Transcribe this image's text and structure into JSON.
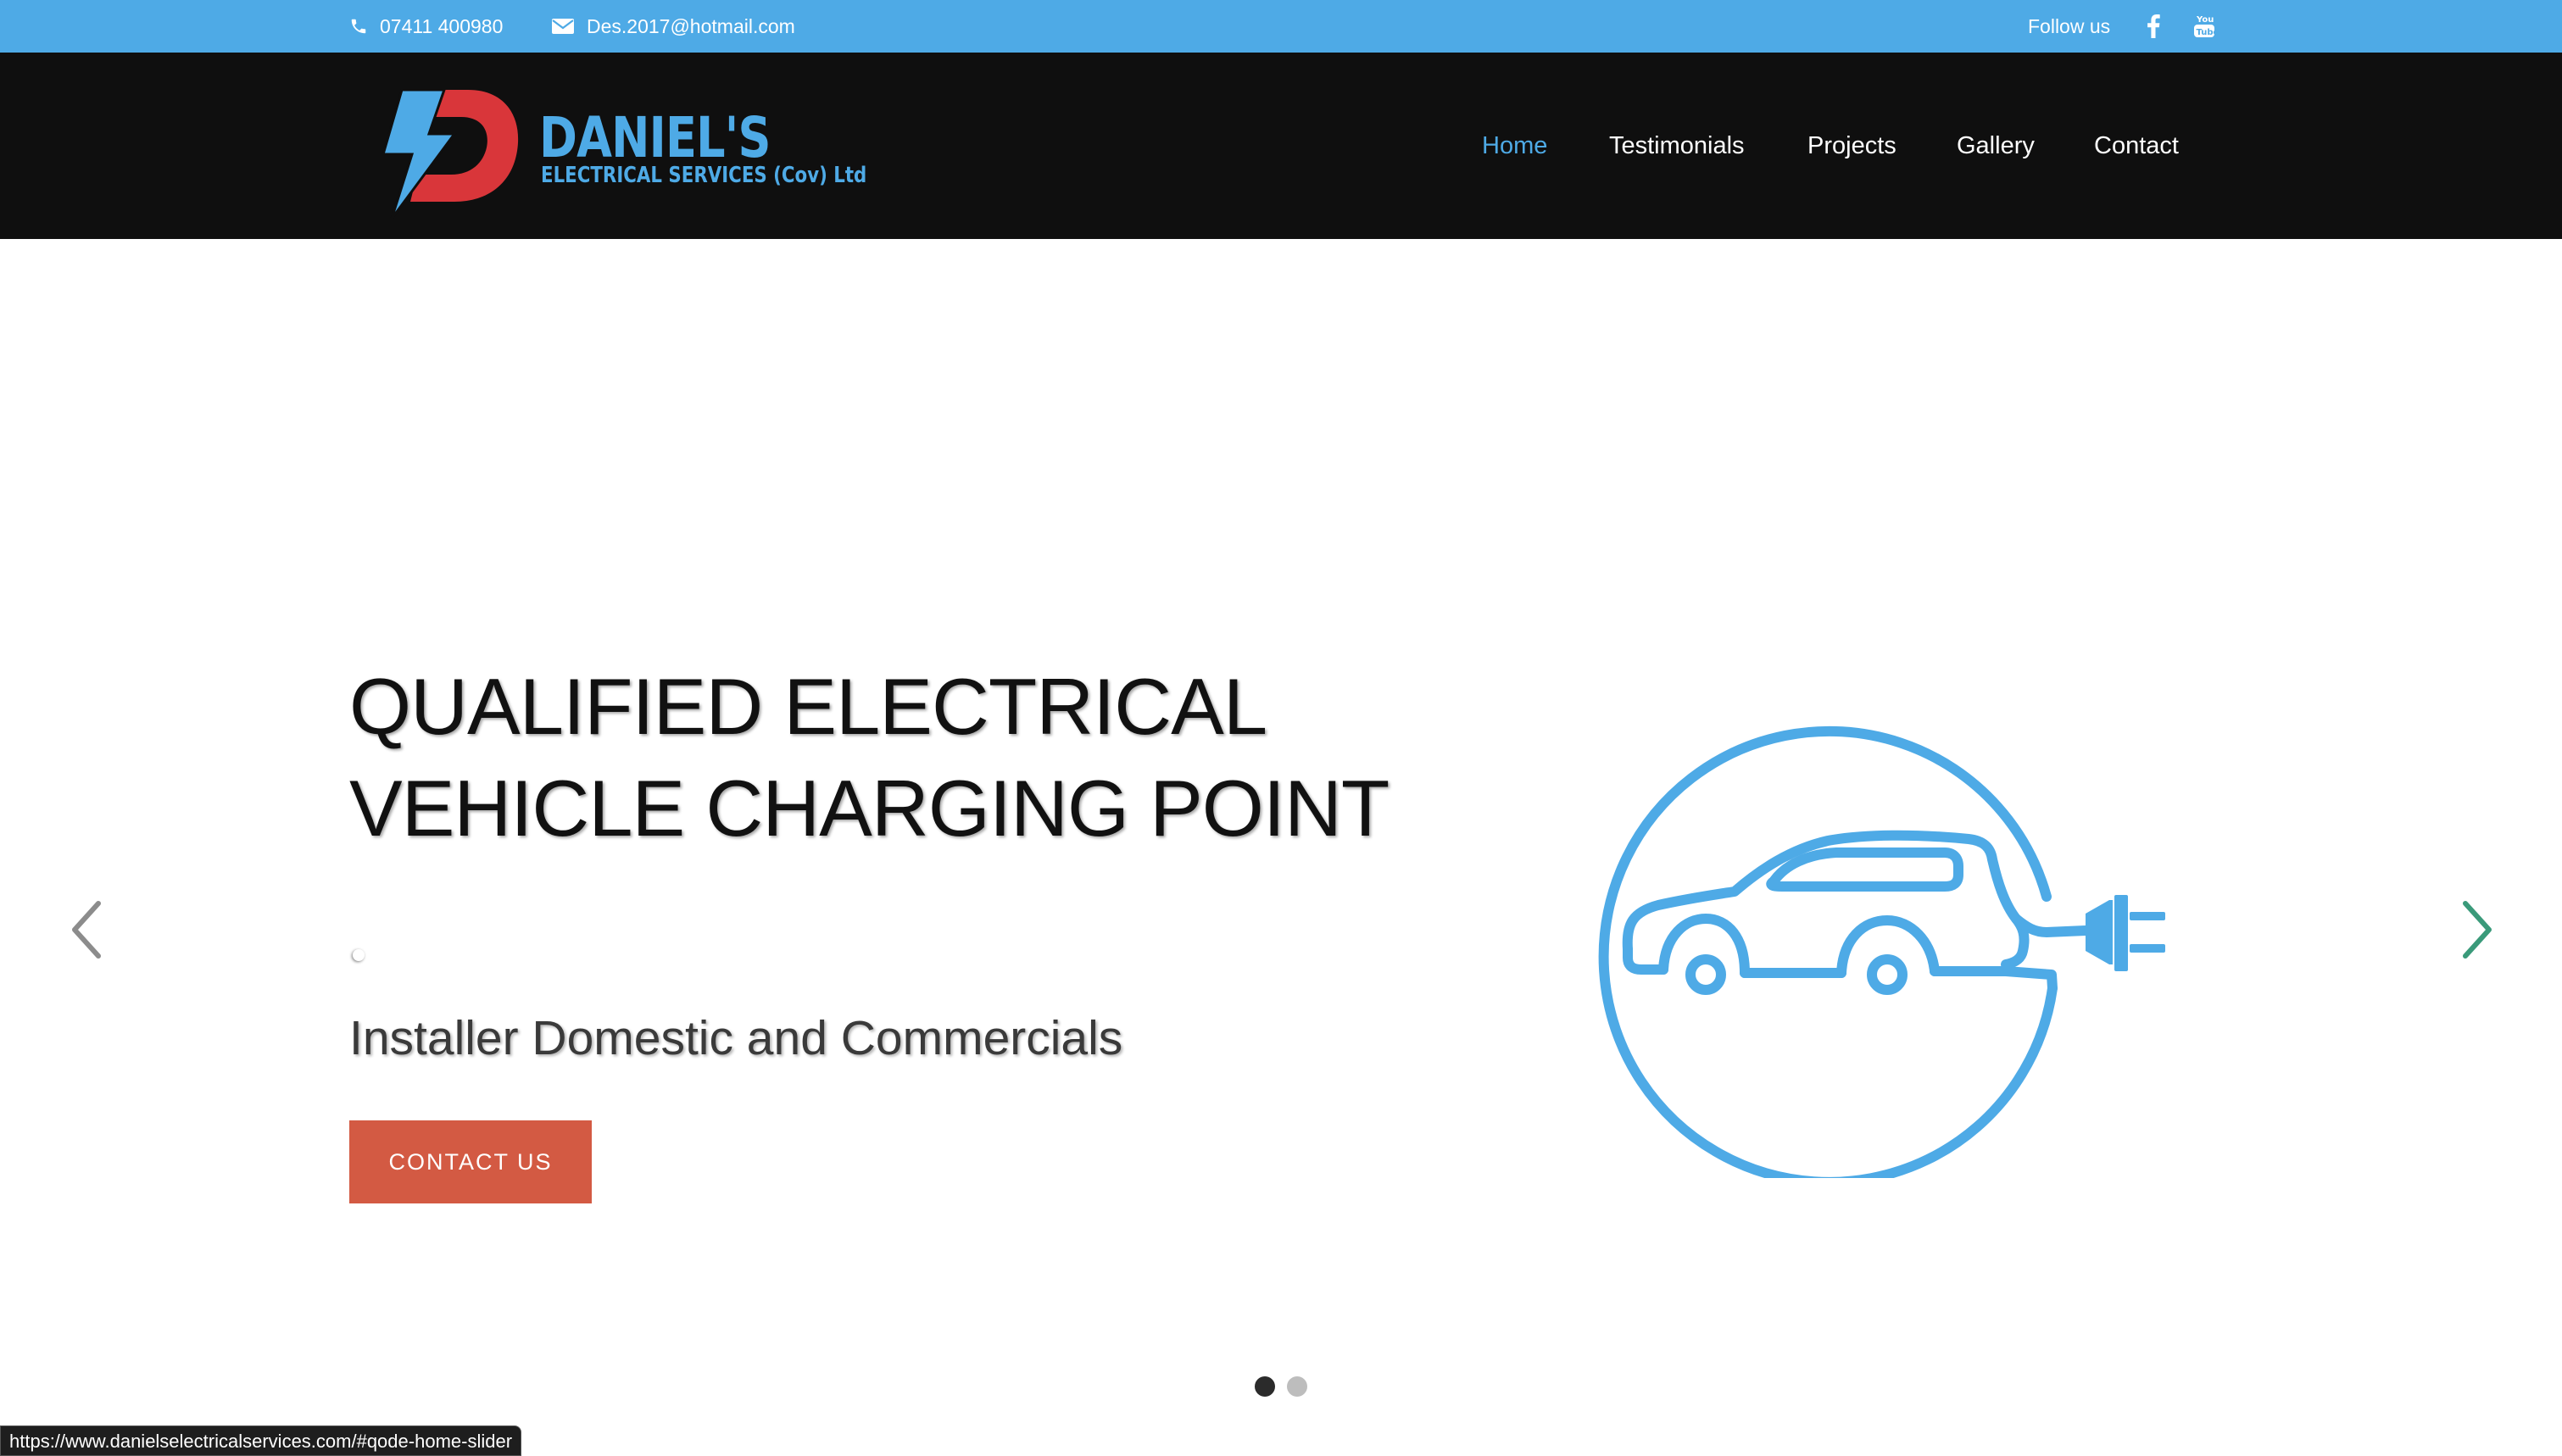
{
  "topbar": {
    "phone": "07411 400980",
    "email": "Des.2017@hotmail.com",
    "follow_label": "Follow us",
    "social": [
      "facebook-icon",
      "youtube-icon"
    ]
  },
  "logo": {
    "word1": "DANIEL'S",
    "word2": "ELECTRICAL SERVICES (Cov) Ltd",
    "colors": {
      "blue": "#4eaae6",
      "red": "#d9363a"
    }
  },
  "nav": {
    "items": [
      {
        "label": "Home",
        "active": true
      },
      {
        "label": "Testimonials",
        "active": false
      },
      {
        "label": "Projects",
        "active": false
      },
      {
        "label": "Gallery",
        "active": false
      },
      {
        "label": "Contact",
        "active": false
      }
    ]
  },
  "slide": {
    "headline_line1": "QUALIFIED ELECTRICAL",
    "headline_line2": "VEHICLE CHARGING POINT",
    "subline": "Installer Domestic and Commercials",
    "cta_label": "CONTACT US",
    "cta_color": "#d35a43",
    "icon": "ev-charging-car-icon",
    "slide_count": 2,
    "active_slide": 1
  },
  "status_bar": {
    "url": "https://www.danielselectricalservices.com/#qode-home-slider"
  },
  "colors": {
    "accent": "#4eaae6",
    "header_bg": "#0f0f0f",
    "arrow_right": "#3a9a7a"
  }
}
